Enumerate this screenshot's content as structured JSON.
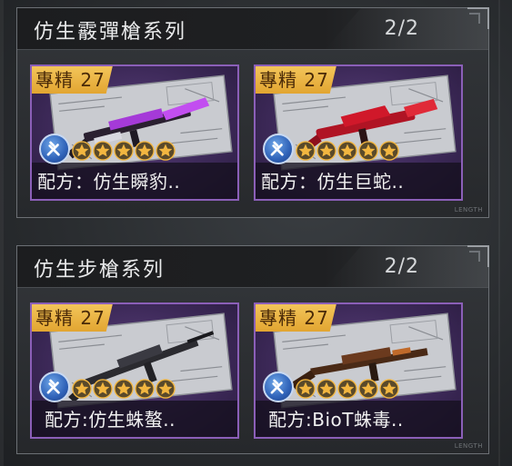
{
  "panels": [
    {
      "title": "仿生霰彈槍系列",
      "count": "2/2",
      "cards": [
        {
          "rank": "專精 27",
          "name": "配方：仿生瞬豹..",
          "stars": 5,
          "weapon_color": "#a53ad8"
        },
        {
          "rank": "專精 27",
          "name": "配方：仿生巨蛇..",
          "stars": 5,
          "weapon_color": "#d0182a"
        }
      ]
    },
    {
      "title": "仿生步槍系列",
      "count": "2/2",
      "cards": [
        {
          "rank": "專精 27",
          "name": "配方:仿生蛛螯..",
          "stars": 5,
          "weapon_color": "#2b2b30"
        },
        {
          "rank": "專精 27",
          "name": "配方:BioT蛛毒..",
          "stars": 5,
          "weapon_color": "#6b3a1e"
        }
      ]
    }
  ],
  "length_tag": "LENGTH",
  "icons": {
    "tool": "wrench-screwdriver-icon",
    "star": "star-icon"
  },
  "colors": {
    "card_border": "#8b5fb8",
    "rank_badge": "#f3c55a",
    "star": "#f2b640"
  }
}
